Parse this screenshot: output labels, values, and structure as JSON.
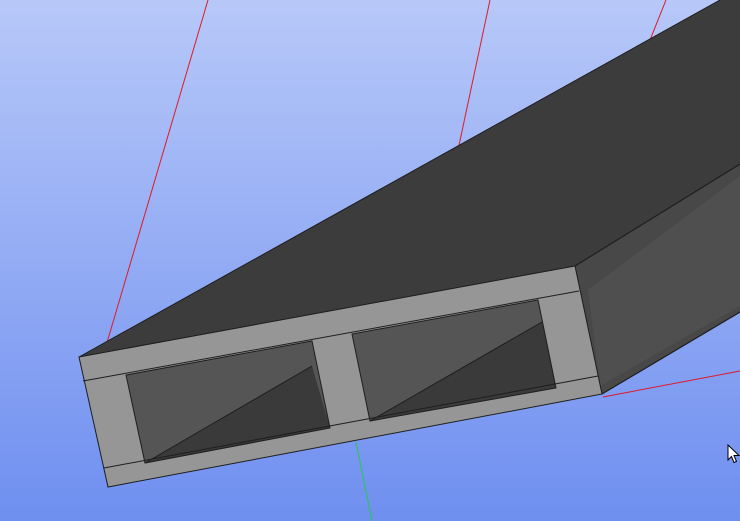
{
  "viewport": {
    "background_top": "#b7c8f8",
    "background_bottom": "#6f8ff0"
  },
  "model": {
    "top_face_color": "#3c3c3c",
    "side_face_color": "#484848",
    "end_frame_color": "#969696",
    "inner_cavity_color": "#555555",
    "inner_shadow_color": "#3a3a3a",
    "edge_color": "#1e1e1e"
  },
  "axes": {
    "x_axis_color": "#e0182b",
    "y_axis_color": "#25c84a"
  },
  "cursor": {
    "icon": "arrow-pointer-icon"
  }
}
